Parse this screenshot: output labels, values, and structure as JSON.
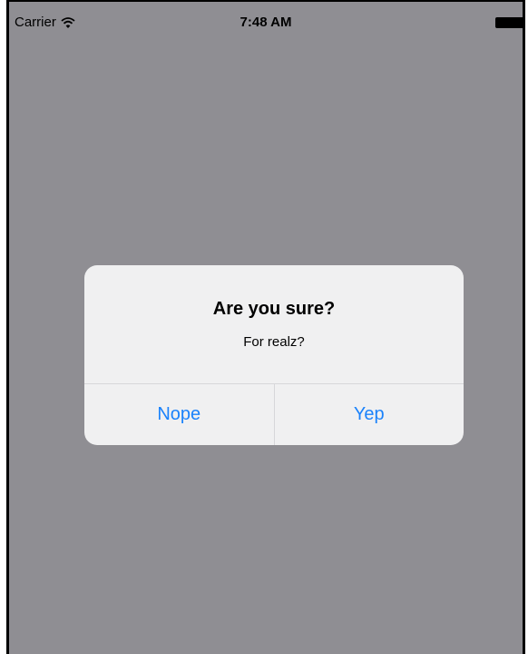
{
  "status_bar": {
    "carrier": "Carrier",
    "time": "7:48 AM",
    "icons": [
      "wifi-icon",
      "battery-icon"
    ]
  },
  "alert": {
    "title": "Are you sure?",
    "message": "For realz?",
    "buttons": [
      {
        "label": "Nope"
      },
      {
        "label": "Yep"
      }
    ]
  },
  "colors": {
    "dimmed_background": "#8f8e93",
    "alert_background": "#f0f0f1",
    "button_text": "#1a82fb",
    "separator": "#d7d7da"
  }
}
